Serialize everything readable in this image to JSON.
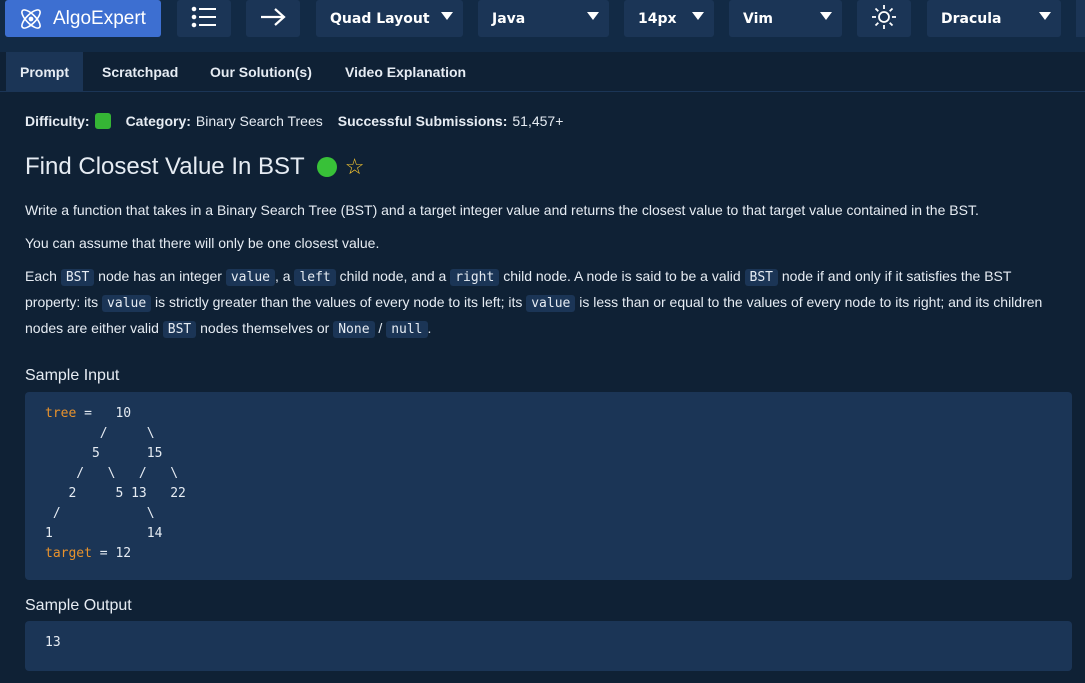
{
  "topbar": {
    "brand": "AlgoExpert",
    "layout_select": "Quad Layout",
    "language_select": "Java",
    "font_size_select": "14px",
    "keybinding_select": "Vim",
    "theme_select": "Dracula"
  },
  "tabs": [
    {
      "label": "Prompt",
      "active": true
    },
    {
      "label": "Scratchpad"
    },
    {
      "label": "Our Solution(s)"
    },
    {
      "label": "Video Explanation"
    }
  ],
  "meta": {
    "difficulty_label": "Difficulty:",
    "difficulty_color": "#35b535",
    "category_label": "Category:",
    "category_value": "Binary Search Trees",
    "submissions_label": "Successful Submissions:",
    "submissions_value": "51,457+"
  },
  "problem": {
    "title": "Find Closest Value In BST",
    "p1": "Write a function that takes in a Binary Search Tree (BST) and a target integer value and returns the closest value to that target value contained in the BST.",
    "p2": "You can assume that there will only be one closest value.",
    "p3": {
      "t1": "Each ",
      "c1": "BST",
      "t2": " node has an integer ",
      "c2": "value",
      "t3": ", a ",
      "c3": "left",
      "t4": " child node, and a ",
      "c4": "right",
      "t5": " child node. A node is said to be a valid ",
      "c5": "BST",
      "t6": " node if and only if it satisfies the BST property: its ",
      "c6": "value",
      "t7": " is strictly greater than the values of every node to its left; its ",
      "c7": "value",
      "t8": " is less than or equal to the values of every node to its right; and its children nodes are either valid ",
      "c8": "BST",
      "t9": " nodes themselves or ",
      "c9": "None",
      "t10": " / ",
      "c10": "null",
      "t11": "."
    }
  },
  "sample_input": {
    "heading": "Sample Input",
    "tree_kw": "tree",
    "tree_eq": " =   10",
    "tree_lines": "       /     \\\n      5      15\n    /   \\   /   \\\n   2     5 13   22\n /           \\\n1            14",
    "target_kw": "target",
    "target_eq": " = 12"
  },
  "sample_output": {
    "heading": "Sample Output",
    "value": "13"
  },
  "colors": {
    "accent": "#3d6fd1",
    "background": "#0f2135",
    "panel": "#1b3556",
    "keyword": "#e8922c",
    "star": "#f4c430"
  }
}
